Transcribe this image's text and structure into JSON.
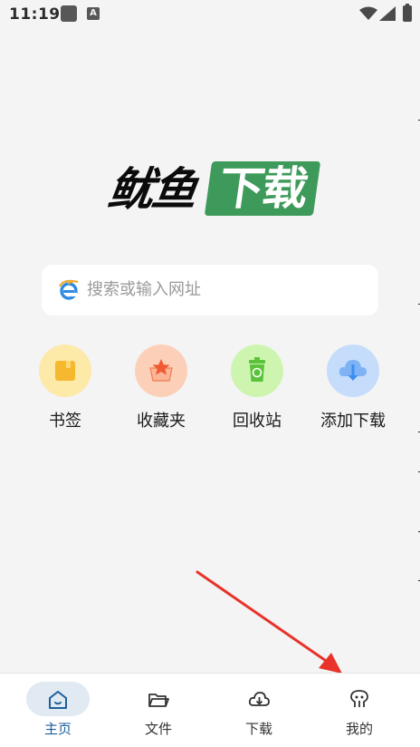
{
  "status_bar": {
    "time": "11:19",
    "notification_letter": "A"
  },
  "logo": {
    "left_text": "鱿鱼",
    "right_text": "下载",
    "accent_color": "#3e9a5a"
  },
  "search": {
    "placeholder": "搜索或输入网址",
    "icon": "ie-browser-icon"
  },
  "quick_actions": [
    {
      "label": "书签",
      "icon": "bookmark-icon",
      "bg": "#fde9a8",
      "color": "#f5b82e"
    },
    {
      "label": "收藏夹",
      "icon": "star-basket-icon",
      "bg": "#fcd0b8",
      "color": "#f05a32"
    },
    {
      "label": "回收站",
      "icon": "recycle-bin-icon",
      "bg": "#cdf5b0",
      "color": "#5cc23c"
    },
    {
      "label": "添加下载",
      "icon": "cloud-download-icon",
      "bg": "#c5dcfb",
      "color": "#3d8df0"
    }
  ],
  "bottom_nav": {
    "active_index": 0,
    "items": [
      {
        "label": "主页",
        "icon": "home-icon"
      },
      {
        "label": "文件",
        "icon": "folder-icon"
      },
      {
        "label": "下载",
        "icon": "cloud-download-icon"
      },
      {
        "label": "我的",
        "icon": "profile-icon"
      }
    ]
  }
}
